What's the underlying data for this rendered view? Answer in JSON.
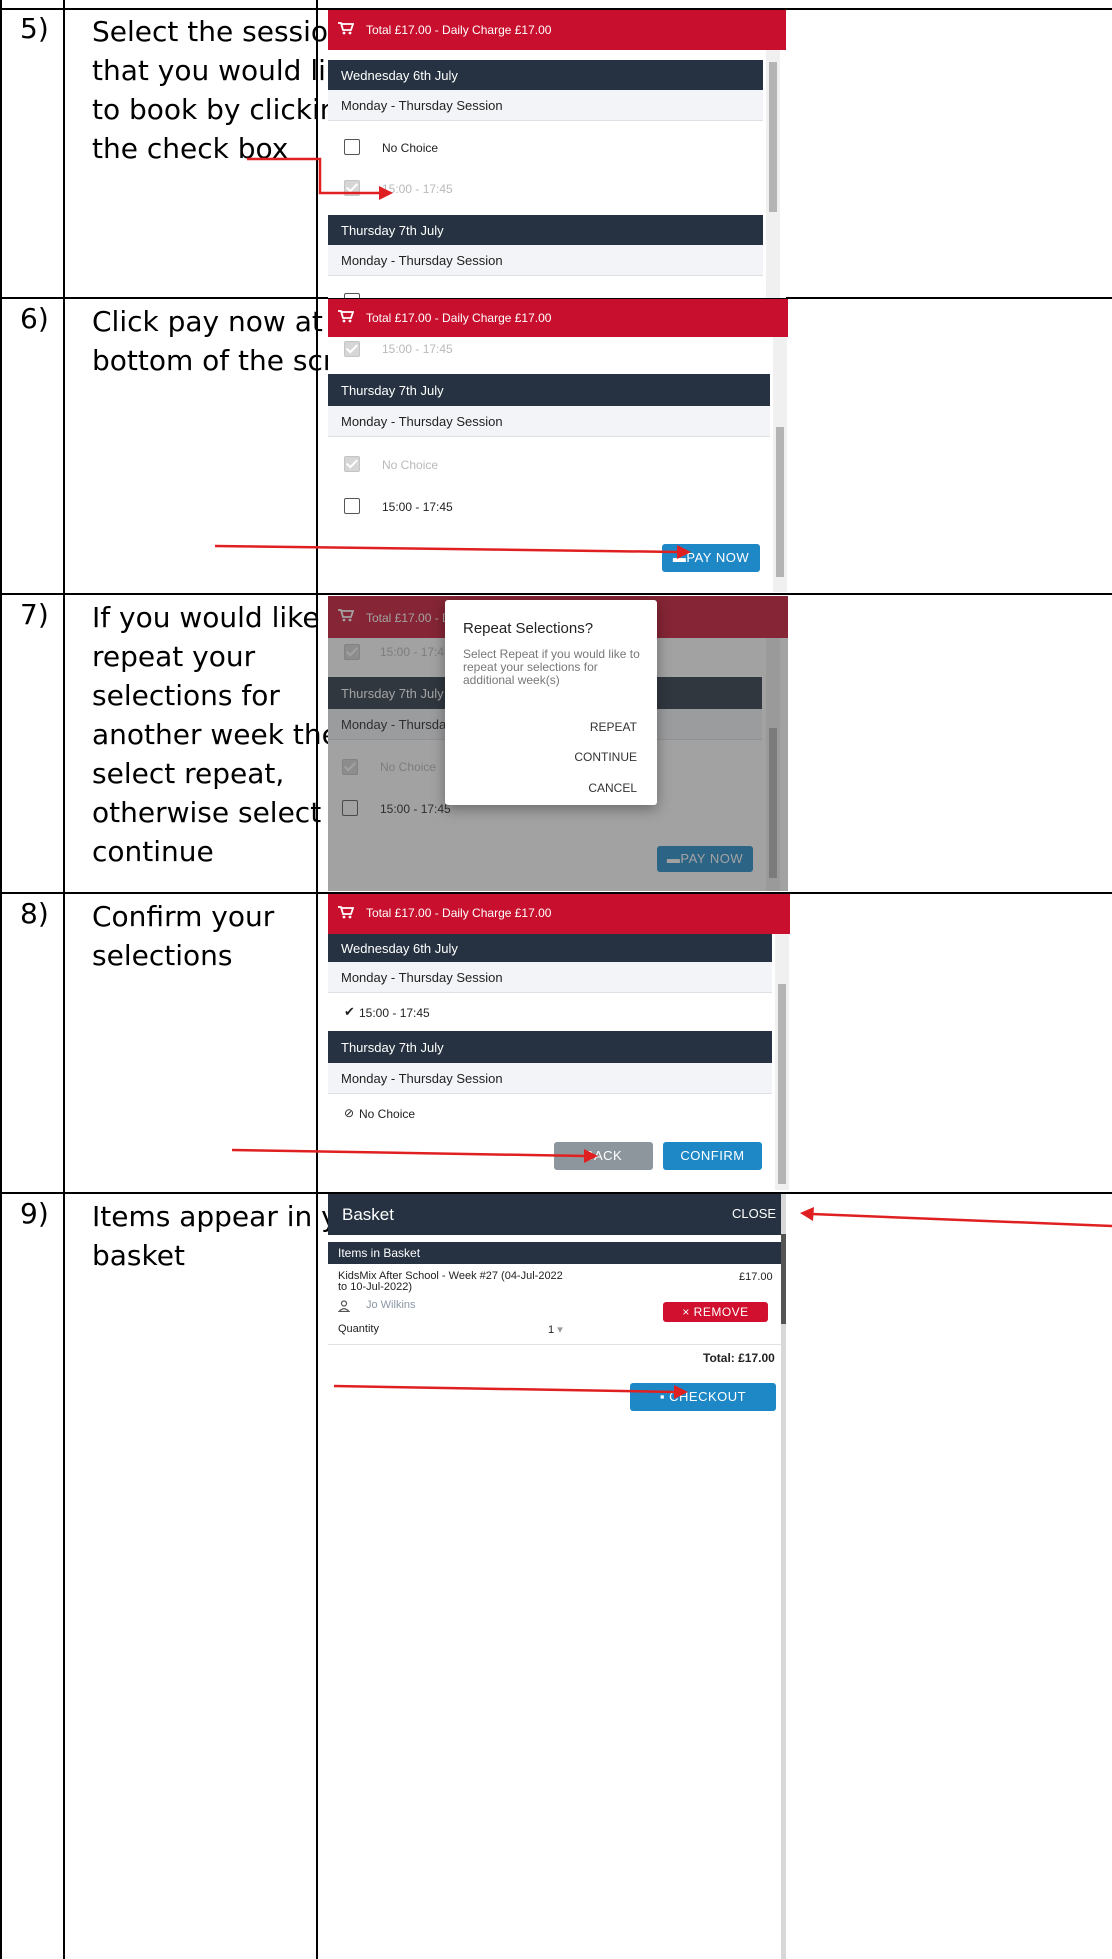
{
  "rows": [
    {
      "num": "5)",
      "instruction": "Select the sessions that you would like to book by clicking in the check box"
    },
    {
      "num": "6)",
      "instruction": "Click pay now at the bottom of the screen"
    },
    {
      "num": "7)",
      "instruction": "If you would like to repeat your selections for another week then select repeat, otherwise select continue"
    },
    {
      "num": "8)",
      "instruction": "Confirm your selections"
    },
    {
      "num": "9)",
      "instruction": "Items appear in your basket"
    }
  ],
  "header_total": "Total £17.00 - Daily Charge £17.00",
  "header_total_short": "Total £17.00 - Daily",
  "wed": "Wednesday 6th July",
  "thu": "Thursday 7th July",
  "session": "Monday - Thursday Session",
  "session_short": "Monday - Thursday Se",
  "opt_none": "No Choice",
  "opt_time": "15:00 - 17:45",
  "pay_now": "PAY NOW",
  "dialog": {
    "title": "Repeat Selections?",
    "body": "Select Repeat if you would like to repeat your selections for additional week(s)",
    "repeat": "REPEAT",
    "continue": "CONTINUE",
    "cancel": "CANCEL"
  },
  "confirm": {
    "back": "BACK",
    "confirm": "CONFIRM"
  },
  "basket": {
    "title": "Basket",
    "close": "CLOSE",
    "items_header": "Items in Basket",
    "item_name": "KidsMix After School - Week #27 (04-Jul-2022 to 10-Jul-2022)",
    "item_price": "£17.00",
    "person": "Jo Wilkins",
    "remove": "REMOVE",
    "quantity_label": "Quantity",
    "quantity_value": "1",
    "total": "Total: £17.00",
    "checkout": "CHECKOUT"
  },
  "colors": {
    "brand_red": "#c8102e",
    "dark_header": "#263241",
    "button_blue": "#1e88c7",
    "arrow_red": "#e02020"
  }
}
